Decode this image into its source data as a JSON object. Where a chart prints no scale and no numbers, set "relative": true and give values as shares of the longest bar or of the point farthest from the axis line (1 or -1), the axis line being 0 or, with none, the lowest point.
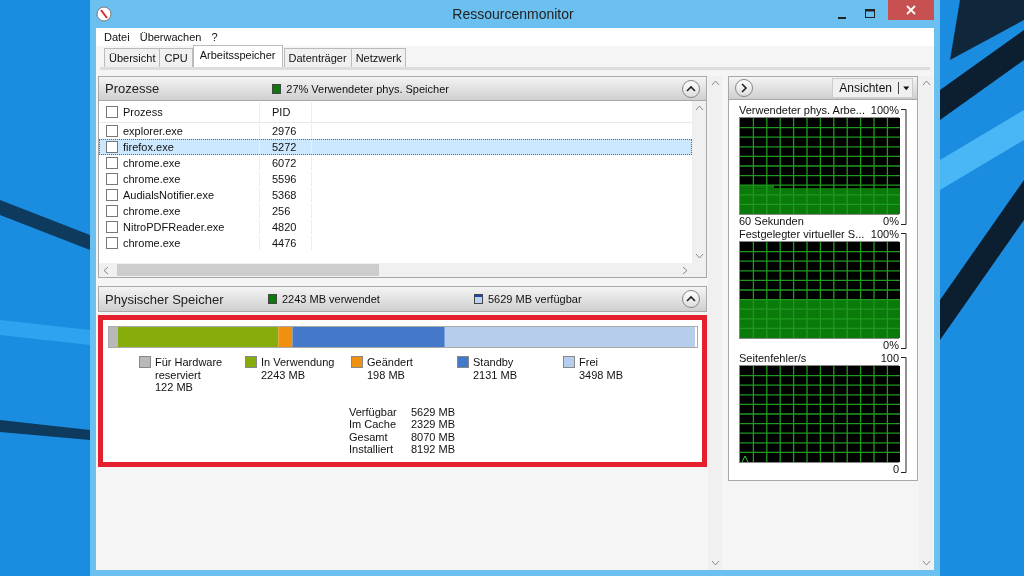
{
  "window": {
    "title": "Ressourcenmonitor"
  },
  "menu": [
    "Datei",
    "Überwachen",
    "?"
  ],
  "tabs": [
    {
      "label": "Übersicht",
      "selected": false
    },
    {
      "label": "CPU",
      "selected": false
    },
    {
      "label": "Arbeitsspeicher",
      "selected": true
    },
    {
      "label": "Datenträger",
      "selected": false
    },
    {
      "label": "Netzwerk",
      "selected": false
    }
  ],
  "processes": {
    "title": "Prozesse",
    "summary": "27% Verwendeter phys. Speicher",
    "expanded": true,
    "columns": [
      "Prozess",
      "PID"
    ],
    "header_checked": false,
    "rows": [
      {
        "name": "explorer.exe",
        "pid": "2976",
        "checked": false,
        "selected": false
      },
      {
        "name": "firefox.exe",
        "pid": "5272",
        "checked": false,
        "selected": true
      },
      {
        "name": "chrome.exe",
        "pid": "6072",
        "checked": false,
        "selected": false
      },
      {
        "name": "chrome.exe",
        "pid": "5596",
        "checked": false,
        "selected": false
      },
      {
        "name": "AudialsNotifier.exe",
        "pid": "5368",
        "checked": false,
        "selected": false
      },
      {
        "name": "chrome.exe",
        "pid": "256",
        "checked": false,
        "selected": false
      },
      {
        "name": "NitroPDFReader.exe",
        "pid": "4820",
        "checked": false,
        "selected": false
      },
      {
        "name": "chrome.exe",
        "pid": "4476",
        "checked": false,
        "selected": false
      }
    ]
  },
  "physical_memory": {
    "title": "Physischer Speicher",
    "used": "2243 MB verwendet",
    "available": "5629 MB verfügbar",
    "expanded": true,
    "highlighted": true,
    "chart_data": {
      "type": "bar",
      "orientation": "horizontal",
      "stacked": true,
      "relative": true,
      "series": [
        {
          "name": "Für Hardware reserviert",
          "color": "#b9b9b9",
          "values": [
            0.015
          ]
        },
        {
          "name": "In Verwendung",
          "color": "#86ad0c",
          "values": [
            0.274
          ]
        },
        {
          "name": "Geändert",
          "color": "#f0900f",
          "values": [
            0.024
          ]
        },
        {
          "name": "Standby",
          "color": "#4379c8",
          "values": [
            0.26
          ]
        },
        {
          "name": "Frei",
          "color": "#b6cdec",
          "values": [
            0.427
          ]
        }
      ]
    },
    "legend_values": [
      "122 MB",
      "2243 MB",
      "198 MB",
      "2131 MB",
      "3498 MB"
    ],
    "totals": [
      {
        "label": "Verfügbar",
        "value": "5629 MB"
      },
      {
        "label": "Im Cache",
        "value": "2329 MB"
      },
      {
        "label": "Gesamt",
        "value": "8070 MB"
      },
      {
        "label": "Installiert",
        "value": "8192 MB"
      }
    ]
  },
  "graphs_panel": {
    "view_button": "Ansichten",
    "graphs": [
      {
        "title": "Verwendeter phys. Arbe...",
        "max": "100%",
        "min": "0%",
        "time": "60 Sekunden"
      },
      {
        "title": "Festgelegter virtueller S...",
        "max": "100%",
        "min": "0%"
      },
      {
        "title": "Seitenfehler/s",
        "max": "100",
        "min": "0"
      }
    ]
  }
}
